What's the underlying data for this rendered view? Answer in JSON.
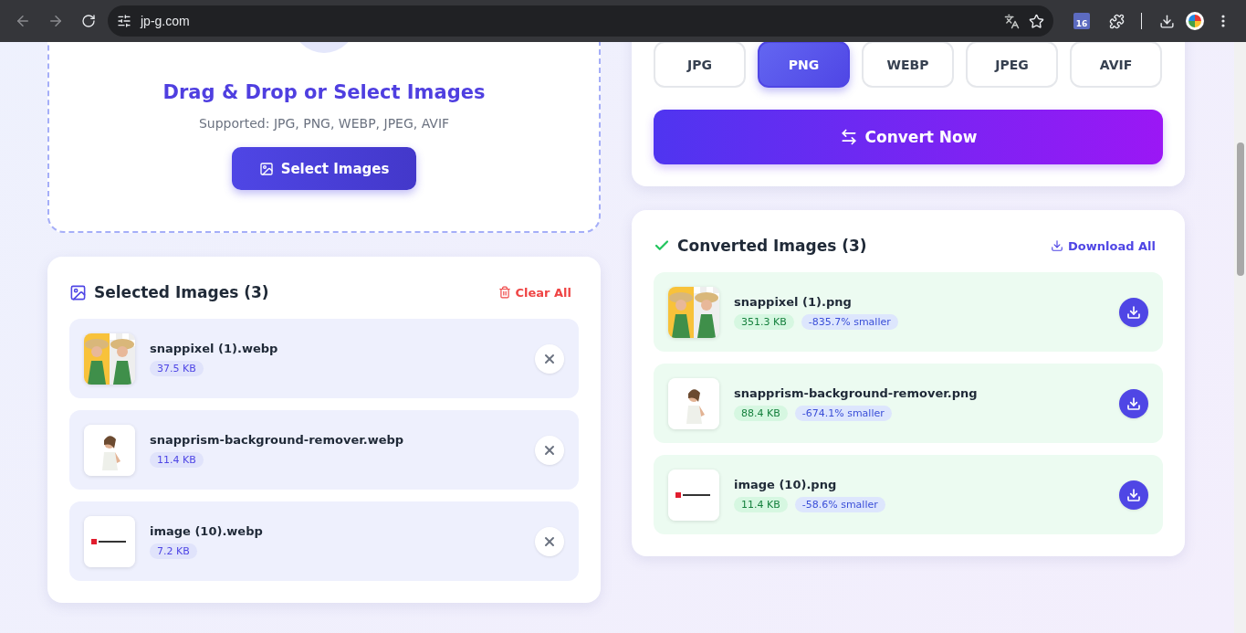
{
  "browser": {
    "url": "jp-g.com",
    "calendar_day": "16"
  },
  "upload": {
    "title": "Drag & Drop or Select Images",
    "supported": "Supported: JPG, PNG, WEBP, JPEG, AVIF",
    "button": "Select Images"
  },
  "selected": {
    "title": "Selected Images (3)",
    "clear_label": "Clear All",
    "items": [
      {
        "name": "snappixel (1).webp",
        "size": "37.5 KB",
        "kind": "picture"
      },
      {
        "name": "snapprism-background-remover.webp",
        "size": "11.4 KB",
        "kind": "picture"
      },
      {
        "name": "image (10).webp",
        "size": "7.2 KB",
        "kind": "picture"
      }
    ]
  },
  "formats": [
    {
      "label": "JPG",
      "selected": false
    },
    {
      "label": "PNG",
      "selected": true
    },
    {
      "label": "WEBP",
      "selected": false
    },
    {
      "label": "JPEG",
      "selected": false
    },
    {
      "label": "AVIF",
      "selected": false
    }
  ],
  "convert_button": "Convert Now",
  "converted": {
    "title": "Converted Images (3)",
    "download_all": "Download All",
    "items": [
      {
        "name": "snappixel (1).png",
        "size": "351.3 KB",
        "change": "-835.7% smaller",
        "kind": "picture"
      },
      {
        "name": "snapprism-background-remover.png",
        "size": "88.4 KB",
        "change": "-674.1% smaller",
        "kind": "picture"
      },
      {
        "name": "image (10).png",
        "size": "11.4 KB",
        "change": "-58.6% smaller",
        "kind": "picture"
      }
    ]
  }
}
